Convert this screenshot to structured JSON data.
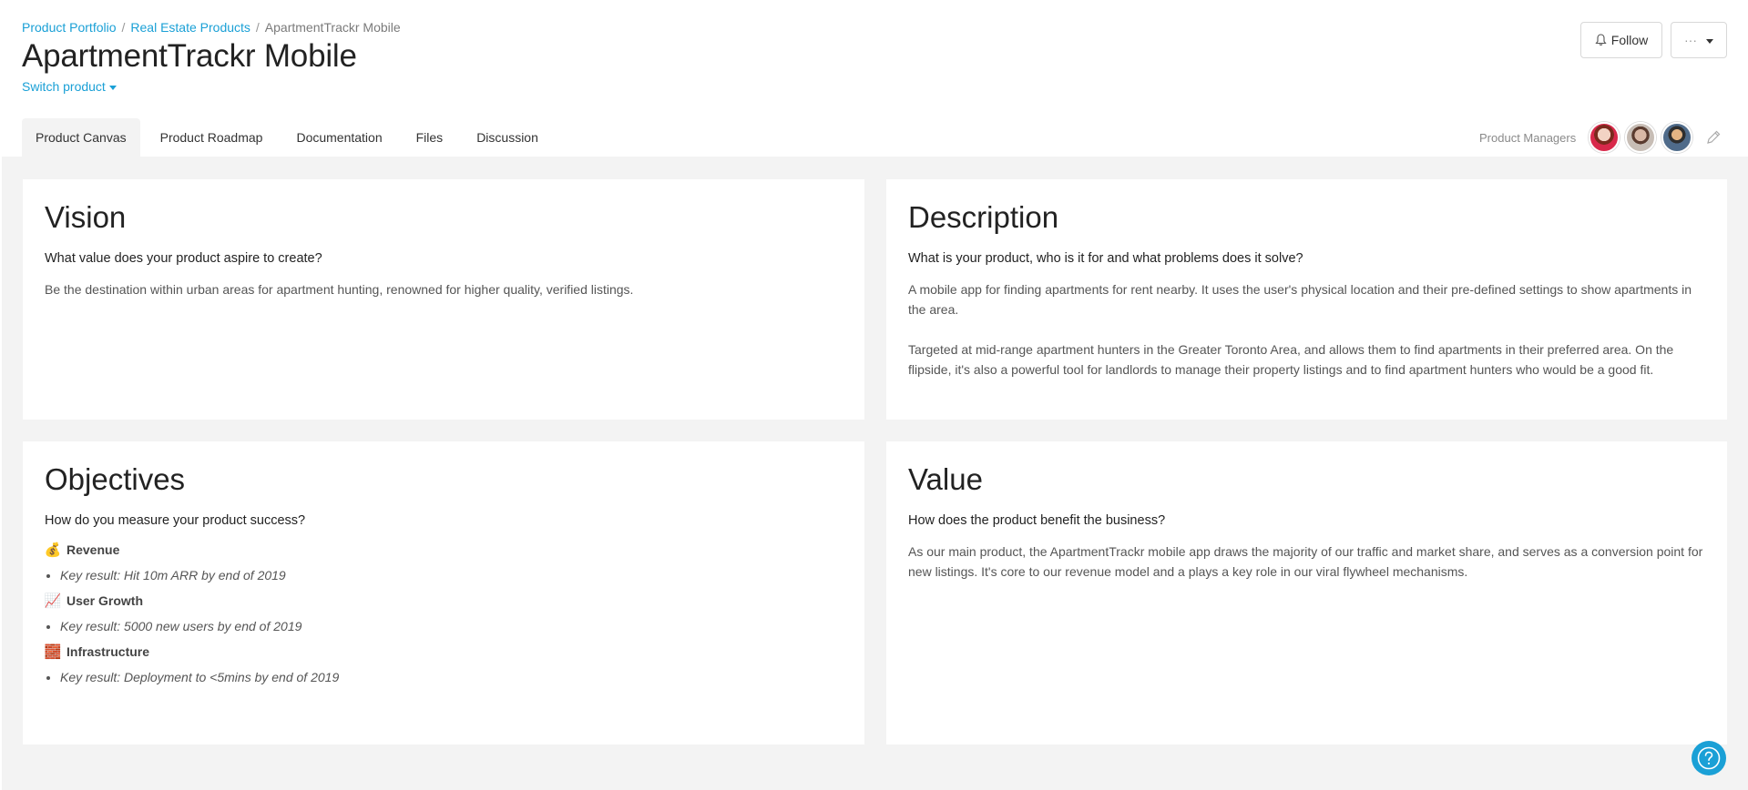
{
  "breadcrumb": {
    "items": [
      "Product Portfolio",
      "Real Estate Products"
    ],
    "current": "ApartmentTrackr Mobile",
    "separator": "/"
  },
  "page": {
    "title": "ApartmentTrackr Mobile",
    "switch_label": "Switch product"
  },
  "actions": {
    "follow_label": "Follow",
    "more_label": "···"
  },
  "tabs": [
    {
      "label": "Product Canvas",
      "active": true
    },
    {
      "label": "Product Roadmap",
      "active": false
    },
    {
      "label": "Documentation",
      "active": false
    },
    {
      "label": "Files",
      "active": false
    },
    {
      "label": "Discussion",
      "active": false
    }
  ],
  "managers": {
    "label": "Product Managers"
  },
  "cards": {
    "vision": {
      "title": "Vision",
      "question": "What value does your product aspire to create?",
      "body": "Be the destination within urban areas for apartment hunting, renowned for higher quality, verified listings."
    },
    "description": {
      "title": "Description",
      "question": "What is your product, who is it for and what problems does it solve?",
      "paragraphs": [
        "A mobile app for finding apartments for rent nearby. It uses the user's physical location and their pre-defined settings to show apartments in the area.",
        "Targeted at mid-range apartment hunters in the Greater Toronto Area, and allows them to find apartments in their preferred area. On the flipside, it's also a powerful tool for landlords to manage their property listings and to find apartment hunters who would be a good fit."
      ]
    },
    "objectives": {
      "title": "Objectives",
      "question": "How do you measure your product success?",
      "items": [
        {
          "emoji": "💰",
          "title": "Revenue",
          "key_result": "Key result: Hit 10m ARR by end of 2019"
        },
        {
          "emoji": "📈",
          "title": "User Growth",
          "key_result": "Key result: 5000 new users by end of 2019"
        },
        {
          "emoji": "🧱",
          "title": "Infrastructure",
          "key_result": "Key result: Deployment to <5mins by end of 2019"
        }
      ]
    },
    "value": {
      "title": "Value",
      "question": "How does the product benefit the business?",
      "body": "As our main product, the ApartmentTrackr mobile app draws the majority of our traffic and market share, and serves as a conversion point for new listings. It's core to our revenue model and a plays a key role in our viral flywheel mechanisms."
    }
  },
  "colors": {
    "accent": "#1aa0d6",
    "background": "#f3f3f3"
  }
}
